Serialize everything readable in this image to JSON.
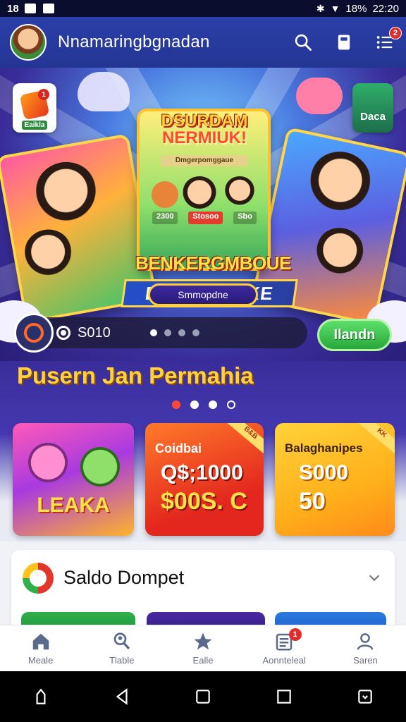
{
  "status_bar": {
    "time_left": "18",
    "battery": "18%",
    "clock": "22:20"
  },
  "app_bar": {
    "title": "Nnamaringbgnadan",
    "notification_count": "2"
  },
  "hero": {
    "corner_logo_label": "Eaikla",
    "corner_logo_badge": "1",
    "right_chip_label": "Daca",
    "card_title_line1": "DSURDAM",
    "card_title_line2": "NERMIUK!",
    "card_sub": "Dmgerpomggaue",
    "card_foot_left": "2300",
    "card_foot_mid": "Stosoo",
    "card_foot_right": "Sbo",
    "banner_line1": "BENKERGMBOUE",
    "banner_line2": "DBL  PEMAKE",
    "banner_pill": "Smmopdne",
    "balance": "S010",
    "cta_label": "Ilandn",
    "slide_dots": 4,
    "active_slide": 0
  },
  "section": {
    "title": "Pusern Jan Permahia",
    "pager": [
      "red",
      "on",
      "on",
      "hollow"
    ]
  },
  "promo_tiles": [
    {
      "label": "LEAKA"
    },
    {
      "heading": "Coidbai",
      "value1": "Q$;1000",
      "value2": "$00S. C",
      "ribbon": "B&B"
    },
    {
      "heading": "Balaghanipes",
      "value1": "S000",
      "value2": "50",
      "ribbon": "KK"
    }
  ],
  "wallet": {
    "title": "Saldo Dompet"
  },
  "bottom_nav": [
    {
      "label": "Meale",
      "icon": "home-icon"
    },
    {
      "label": "Tlable",
      "icon": "search-people-icon"
    },
    {
      "label": "Ealle",
      "icon": "star-icon"
    },
    {
      "label": "Aonnteleal",
      "icon": "document-icon",
      "badge": "1"
    },
    {
      "label": "Saren",
      "icon": "profile-icon"
    }
  ],
  "colors": {
    "app_bar": "#2a3fa8",
    "accent_yellow": "#ffd23a",
    "cta_green": "#27a83a",
    "badge_red": "#e22b2b"
  }
}
